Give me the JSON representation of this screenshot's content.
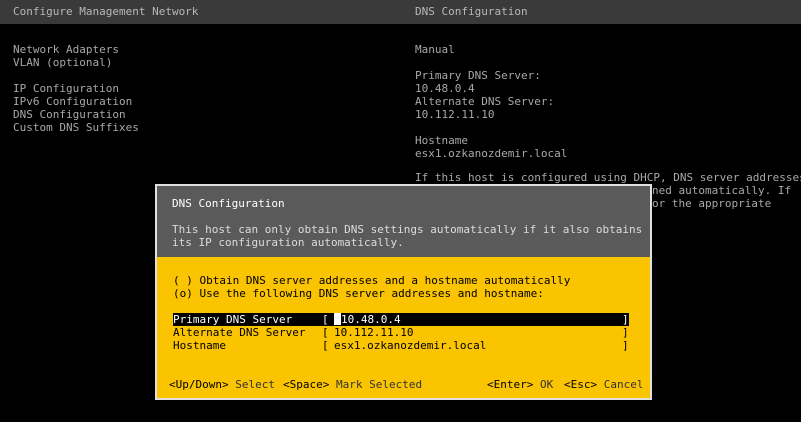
{
  "header": {
    "left_title": "Configure Management Network",
    "right_title": "DNS Configuration"
  },
  "menu": {
    "items": [
      "Network Adapters",
      "VLAN (optional)",
      "IP Configuration",
      "IPv6 Configuration",
      "DNS Configuration",
      "Custom DNS Suffixes"
    ]
  },
  "info": {
    "mode": "Manual",
    "primary_label": "Primary DNS Server:",
    "primary_value": "10.48.0.4",
    "alternate_label": "Alternate DNS Server:",
    "alternate_value": "10.112.11.10",
    "hostname_label": "Hostname",
    "hostname_value": "esx1.ozkanozdemir.local",
    "dhcp_line1": "If this host is configured using DHCP, DNS server addresses",
    "dhcp_line2": "ned automatically. If",
    "dhcp_line3": "or the appropriate"
  },
  "dialog": {
    "title": "DNS Configuration",
    "desc_line1": "This host can only obtain DNS settings automatically if it also obtains",
    "desc_line2": "its IP configuration automatically.",
    "option_auto": "( ) Obtain DNS server addresses and a hostname automatically",
    "option_manual": "(o) Use the following DNS server addresses and hostname:",
    "fields": {
      "primary_label": "Primary DNS Server",
      "primary_value": "10.48.0.4",
      "alternate_label": "Alternate DNS Server",
      "alternate_value": "10.112.11.10",
      "hostname_label": "Hostname",
      "hostname_value": "esx1.ozkanozdemir.local"
    },
    "footer": {
      "updown_key": "<Up/Down>",
      "updown_label": "Select",
      "space_key": "<Space>",
      "space_label": "Mark Selected",
      "enter_key": "<Enter>",
      "enter_label": "OK",
      "esc_key": "<Esc>",
      "esc_label": "Cancel"
    }
  }
}
